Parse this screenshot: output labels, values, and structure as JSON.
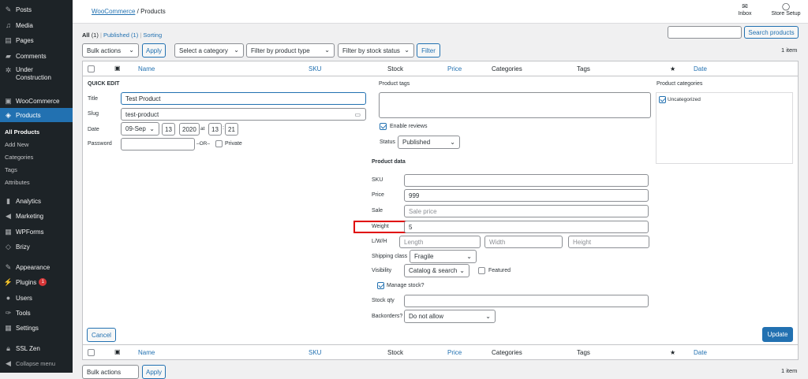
{
  "sidebar": {
    "items": [
      {
        "label": "Posts",
        "icon": "pin-icon"
      },
      {
        "label": "Media",
        "icon": "media-icon"
      },
      {
        "label": "Pages",
        "icon": "pages-icon"
      },
      {
        "label": "Comments",
        "icon": "comments-icon"
      },
      {
        "label": "Under Construction",
        "icon": "gear-icon"
      },
      {
        "label": "WooCommerce",
        "icon": "woocommerce-icon"
      },
      {
        "label": "Products",
        "icon": "products-icon"
      },
      {
        "label": "Analytics",
        "icon": "analytics-icon"
      },
      {
        "label": "Marketing",
        "icon": "megaphone-icon"
      },
      {
        "label": "WPForms",
        "icon": "wpforms-icon"
      },
      {
        "label": "Brizy",
        "icon": "brizy-icon"
      },
      {
        "label": "Appearance",
        "icon": "brush-icon"
      },
      {
        "label": "Plugins",
        "icon": "plugin-icon",
        "badge": "1"
      },
      {
        "label": "Users",
        "icon": "users-icon"
      },
      {
        "label": "Tools",
        "icon": "wrench-icon"
      },
      {
        "label": "Settings",
        "icon": "settings-icon"
      },
      {
        "label": "SSL Zen",
        "icon": "lock-icon"
      },
      {
        "label": "Collapse menu",
        "icon": "collapse-icon"
      }
    ],
    "submenu": [
      "All Products",
      "Add New",
      "Categories",
      "Tags",
      "Attributes"
    ]
  },
  "header": {
    "breadcrumb_link": "WooCommerce",
    "breadcrumb_sep": "/",
    "breadcrumb_current": "Products",
    "inbox": "Inbox",
    "store_setup": "Store Setup"
  },
  "filters": {
    "all": "All",
    "all_count": "(1)",
    "sep1": "|",
    "published": "Published",
    "published_count": "(1)",
    "sep2": "|",
    "sorting": "Sorting",
    "bulk_actions": "Bulk actions",
    "apply": "Apply",
    "category": "Select a category",
    "product_type": "Filter by product type",
    "stock_status": "Filter by stock status",
    "filter": "Filter",
    "search_button": "Search products",
    "item_count": "1 item",
    "bottom_item_count": "1 item",
    "bottom_bulk": "Bulk actions",
    "bottom_apply": "Apply"
  },
  "table": {
    "columns": [
      "Name",
      "SKU",
      "Stock",
      "Price",
      "Categories",
      "Tags",
      "★",
      "Date"
    ]
  },
  "quick_edit": {
    "heading": "QUICK EDIT",
    "title_label": "Title",
    "title_value": "Test Product",
    "slug_label": "Slug",
    "slug_value": "test-product",
    "date_label": "Date",
    "date_month": "09-Sep",
    "date_day": "13",
    "date_year": "2020",
    "date_at": "at",
    "date_hour": "13",
    "date_colon": ":",
    "date_min": "21",
    "password_label": "Password",
    "or": "–OR–",
    "private": "Private",
    "tags_label": "Product tags",
    "enable_reviews": "Enable reviews",
    "status_label": "Status",
    "status_value": "Published",
    "categories_label": "Product categories",
    "category_item": "Uncategorized",
    "product_data": "Product data",
    "sku_label": "SKU",
    "price_label": "Price",
    "price_value": "999",
    "sale_label": "Sale",
    "sale_placeholder": "Sale price",
    "weight_label": "Weight",
    "weight_value": "5",
    "lwh_label": "L/W/H",
    "length_ph": "Length",
    "width_ph": "Width",
    "height_ph": "Height",
    "shipping_label": "Shipping class",
    "shipping_value": "Fragile",
    "visibility_label": "Visibility",
    "visibility_value": "Catalog & search",
    "featured": "Featured",
    "manage_stock": "Manage stock?",
    "stock_qty_label": "Stock qty",
    "backorders_label": "Backorders?",
    "backorders_value": "Do not allow",
    "cancel": "Cancel",
    "update": "Update"
  },
  "colors": {
    "accent": "#2271b1",
    "sidebar": "#1d2327",
    "highlight": "#d63638"
  }
}
